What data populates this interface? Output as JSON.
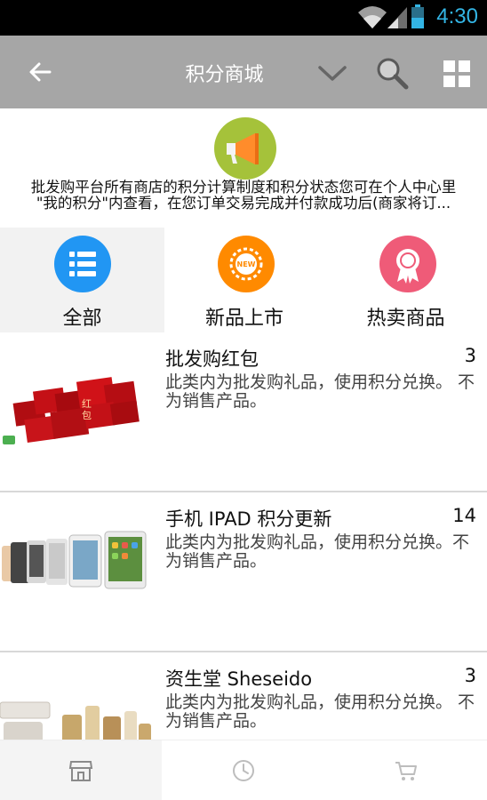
{
  "status_bar": {
    "time": "4:30",
    "icons": [
      "wifi-icon",
      "signal-icon",
      "battery-icon"
    ]
  },
  "app_bar": {
    "title": "积分商城",
    "icons": [
      "back-arrow-icon",
      "chevron-down-icon",
      "search-icon",
      "grid-icon"
    ]
  },
  "notice": {
    "icon": "megaphone-icon",
    "line1": "批发购平台所有商店的积分计算制度和积分状态您可在个人中心里",
    "line2": "\"我的积分\"内查看，在您订单交易完成并付款成功后(商家将订..."
  },
  "categories": [
    {
      "label": "全部",
      "icon": "list-icon",
      "color": "#2196f3",
      "selected": true
    },
    {
      "label": "新品上市",
      "icon": "new-badge-icon",
      "color": "#ff8a00",
      "selected": false
    },
    {
      "label": "热卖商品",
      "icon": "award-ribbon-icon",
      "color": "#ef5b78",
      "selected": false
    }
  ],
  "products": [
    {
      "name": "批发购红包",
      "count": "3",
      "desc": "此类内为批发购礼品，使用积分兑换。 不为销售产品。",
      "image": "red-envelopes-image"
    },
    {
      "name": "手机 IPAD 积分更新",
      "count": "14",
      "desc": "此类内为批发购礼品，使用积分兑换。不为销售产品。",
      "image": "phones-and-tablets-image"
    },
    {
      "name": "资生堂 Sheseido",
      "count": "3",
      "desc": "此类内为批发购礼品，使用积分兑换。 不为销售产品。",
      "image": "cosmetics-image"
    }
  ],
  "bottom_nav": [
    {
      "icon": "store-icon",
      "active": true
    },
    {
      "icon": "clock-icon",
      "active": false
    },
    {
      "icon": "cart-icon",
      "active": false
    }
  ],
  "colors": {
    "app_bar": "#a6a6a6",
    "status_time": "#33b5e5",
    "megaphone_bg": "#a5c23a"
  }
}
